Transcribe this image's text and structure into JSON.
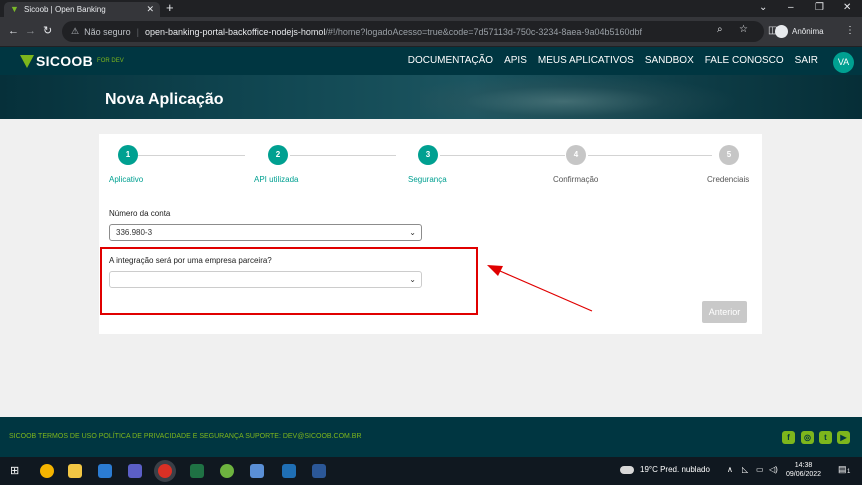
{
  "browser": {
    "tab_title": "Sicoob | Open Banking",
    "tab_close": "✕",
    "new_tab": "+",
    "security_label": "Não seguro",
    "url_host": "open-banking-portal-backoffice-nodejs-homol",
    "url_path": "/#!/home?logadoAcesso=true&code=7d57113d-750c-3234-8aea-9a04b5160dbf",
    "profile_label": "Anônima",
    "window_controls": [
      "⌄",
      "–",
      "❐",
      "✕"
    ]
  },
  "site": {
    "logo_text": "SICOOB",
    "logo_tag": "FOR DEV",
    "menu": [
      "DOCUMENTAÇÃO",
      "APIS",
      "MEUS APLICATIVOS",
      "SANDBOX",
      "FALE CONOSCO",
      "SAIR"
    ],
    "user_initials": "VA",
    "page_title": "Nova Aplicação"
  },
  "wizard": {
    "steps": [
      {
        "number": "1",
        "label": "Aplicativo",
        "state": "done"
      },
      {
        "number": "2",
        "label": "API utilizada",
        "state": "done"
      },
      {
        "number": "3",
        "label": "Segurança",
        "state": "done"
      },
      {
        "number": "4",
        "label": "Confirmação",
        "state": "todo"
      },
      {
        "number": "5",
        "label": "Credenciais",
        "state": "todo"
      }
    ],
    "account_label": "Número da conta",
    "account_value": "336.980-3",
    "partner_label": "A integração será por uma empresa parceira?",
    "partner_value": "",
    "back_button": "Anterior"
  },
  "annotation": {
    "color": "#e00000"
  },
  "footer": {
    "links": "SICOOB  TERMOS DE USO  POLÍTICA DE PRIVACIDADE E SEGURANÇA  SUPORTE: DEV@SICOOB.COM.BR",
    "social_icons": [
      "facebook-icon",
      "instagram-icon",
      "twitter-icon",
      "youtube-icon"
    ]
  },
  "taskbar": {
    "weather": "19°C  Pred. nublado",
    "time": "14:38",
    "date": "09/06/2022",
    "notifications": "1"
  },
  "colors": {
    "brand_dark": "#003641",
    "brand_green": "#7db61c",
    "brand_teal": "#00a091"
  }
}
